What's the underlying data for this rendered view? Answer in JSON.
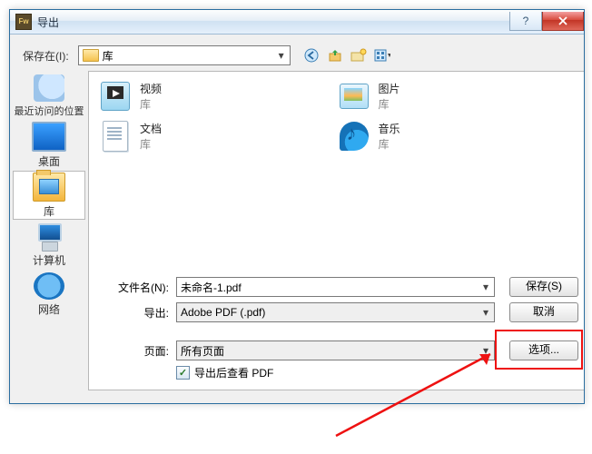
{
  "window": {
    "title": "导出"
  },
  "save_in": {
    "label": "保存在(I):",
    "value": "库"
  },
  "sidebar": {
    "items": [
      {
        "label": "最近访问的位置"
      },
      {
        "label": "桌面"
      },
      {
        "label": "库"
      },
      {
        "label": "计算机"
      },
      {
        "label": "网络"
      }
    ]
  },
  "libraries": {
    "sub": "库",
    "items": [
      {
        "name": "视频"
      },
      {
        "name": "图片"
      },
      {
        "name": "文档"
      },
      {
        "name": "音乐"
      }
    ]
  },
  "form": {
    "file_name_label": "文件名(N):",
    "file_name_value": "未命名-1.pdf",
    "export_label": "导出:",
    "export_value": "Adobe PDF (.pdf)",
    "pages_label": "页面:",
    "pages_value": "所有页面",
    "checkbox_label": "导出后查看 PDF"
  },
  "buttons": {
    "save": "保存(S)",
    "cancel": "取消",
    "options": "选项..."
  }
}
